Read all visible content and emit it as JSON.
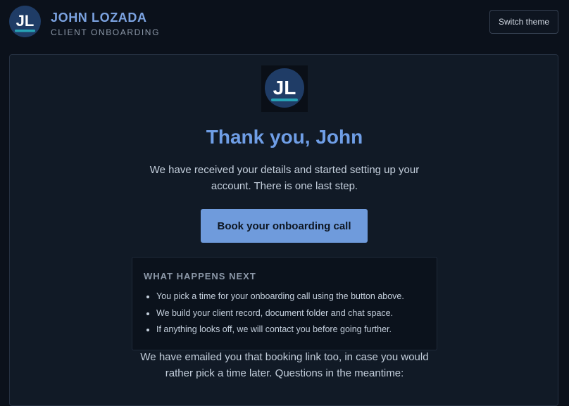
{
  "colors": {
    "background": "#0b111b",
    "card": "#111a26",
    "accent": "#6f9ee6",
    "button": "#6f9bdc",
    "logo_circle": "#1f3c66",
    "logo_underline": "#27a3b5"
  },
  "header": {
    "logo_monogram": "JL",
    "brand_name": "JOHN LOZADA",
    "brand_subtitle": "CLIENT ONBOARDING",
    "theme_button_label": "Switch theme"
  },
  "main": {
    "logo_monogram": "JL",
    "title": "Thank you, John",
    "lead": "We have received your details and started setting up your account. There is one last step.",
    "cta_label": "Book your onboarding call",
    "next_steps": {
      "title": "WHAT HAPPENS NEXT",
      "items": [
        "You pick a time for your onboarding call using the button above.",
        "We build your client record, document folder and chat space.",
        "If anything looks off, we will contact you before going further."
      ]
    },
    "footer_text": "We have emailed you that booking link too, in case you would rather pick a time later. Questions in the meantime:"
  }
}
